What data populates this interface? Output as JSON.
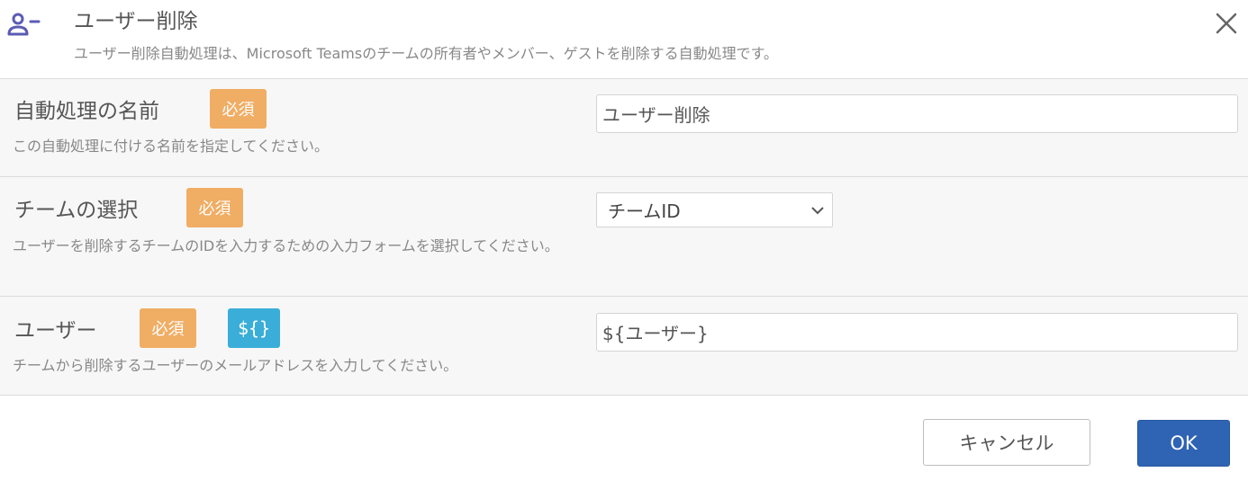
{
  "dialog": {
    "title": "ユーザー削除",
    "description": "ユーザー削除自動処理は、Microsoft Teamsのチームの所有者やメンバー、ゲストを削除する自動処理です。",
    "icon": "user-minus-icon",
    "close_icon": "close-icon"
  },
  "fields": {
    "name": {
      "label": "自動処理の名前",
      "required_badge": "必須",
      "help": "この自動処理に付ける名前を指定してください。",
      "value": "ユーザー削除"
    },
    "team": {
      "label": "チームの選択",
      "required_badge": "必須",
      "help": "ユーザーを削除するチームのIDを入力するための入力フォームを選択してください。",
      "selected": "チームID"
    },
    "user": {
      "label": "ユーザー",
      "required_badge": "必須",
      "variable_badge": "${}",
      "help": "チームから削除するユーザーのメールアドレスを入力してください。",
      "value": "${ユーザー}"
    }
  },
  "footer": {
    "cancel_label": "キャンセル",
    "ok_label": "OK"
  },
  "colors": {
    "required_badge": "#f0ad64",
    "variable_badge": "#3aaed8",
    "ok_button": "#2f63b3",
    "icon": "#5b5bb5"
  }
}
